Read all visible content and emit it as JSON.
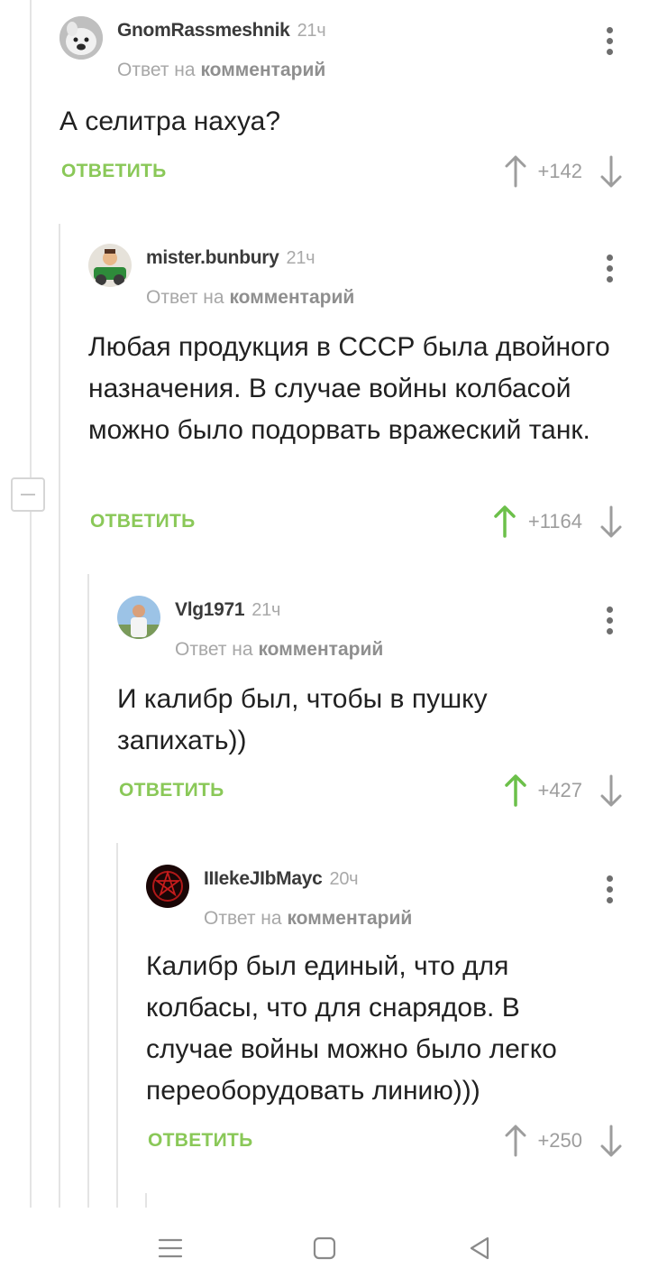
{
  "comments": [
    {
      "username": "GnomRassmeshnik",
      "time": "21ч",
      "reply_prefix": "Ответ на",
      "reply_target": "комментарий",
      "text": "А селитра нахуа?",
      "reply_label": "ОТВЕТИТЬ",
      "score": "+142",
      "upvoted": false
    },
    {
      "username": "mister.bunbury",
      "time": "21ч",
      "reply_prefix": "Ответ на",
      "reply_target": "комментарий",
      "text": "Любая продукция в СССР была двойного назначения. В случае войны колбасой можно было подорвать вражеский танк.",
      "reply_label": "ОТВЕТИТЬ",
      "score": "+1164",
      "upvoted": true
    },
    {
      "username": "Vlg1971",
      "time": "21ч",
      "reply_prefix": "Ответ на",
      "reply_target": "комментарий",
      "text": "И калибр был, чтобы в пушку запихать))",
      "reply_label": "ОТВЕТИТЬ",
      "score": "+427",
      "upvoted": true
    },
    {
      "username": "IIIekeJIbMayc",
      "time": "20ч",
      "reply_prefix": "Ответ на",
      "reply_target": "комментарий",
      "text": "Калибр был единый, что для колбасы, что для снарядов. В случае войны можно было легко переоборудовать линию)))",
      "reply_label": "ОТВЕТИТЬ",
      "score": "+250",
      "upvoted": false
    }
  ],
  "icons": {
    "more": "more-vertical-icon",
    "upvote": "arrow-up-icon",
    "downvote": "arrow-down-icon",
    "collapse": "minus-icon"
  },
  "colors": {
    "accent_green": "#8ac858",
    "vote_gray": "#9d9d9d",
    "upvoted_green": "#6cc04a"
  },
  "navbar": [
    "menu-icon",
    "home-square-icon",
    "back-triangle-icon"
  ]
}
